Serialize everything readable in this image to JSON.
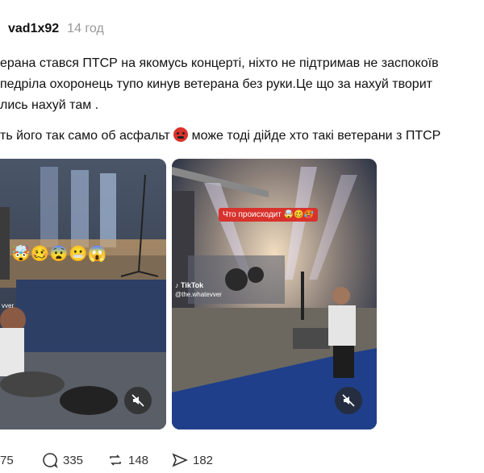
{
  "post": {
    "username": "vad1x92",
    "timestamp": "14 год",
    "lines": [
      "ерана стався ПТСР на якомусь концерті, ніхто не підтримав не заспокоїв",
      "педріла охоронець тупо кинув ветерана без руки.Це що за нахуй творит",
      "лись нахуй там ."
    ],
    "line4_before": "ть його так само об асфальт ",
    "line4_after": " може тоді дійде хто такі ветерани з ПТСР"
  },
  "media": {
    "left": {
      "emoji_overlay": "🤯🥴😨😬😱",
      "mute_icon": "mute-icon"
    },
    "right": {
      "caption": "Что происходит 🤯🥴🥵",
      "tiktok_brand": "TikTok",
      "tiktok_handle": "@the.whatevver",
      "mute_icon": "mute-icon"
    }
  },
  "actions": {
    "likes": "75",
    "replies": "335",
    "reposts": "148",
    "shares": "182"
  },
  "colors": {
    "caption_bg": "#d8322c",
    "timestamp": "#999999"
  }
}
